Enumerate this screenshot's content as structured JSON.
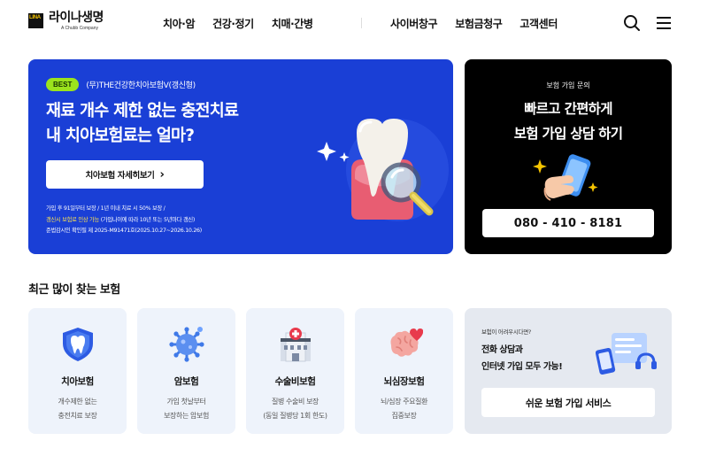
{
  "header": {
    "logo_mark": "LINA",
    "logo_name": "라이나생명",
    "logo_sub": "A Chubb Company",
    "nav_main": [
      "치아·암",
      "건강·정기",
      "치매·간병"
    ],
    "nav_sub": [
      "사이버창구",
      "보험금청구",
      "고객센터"
    ],
    "search_icon": "search-icon",
    "menu_icon": "hamburger-menu-icon"
  },
  "hero": {
    "badge": "BEST",
    "product": "(무)THE건강한치아보험V(갱신형)",
    "title_line1": "재료 개수 제한 없는 충전치료",
    "title_line2": "내 치아보험료는 얼마?",
    "button_label": "치아보험 자세히보기",
    "button_arrow": "›",
    "note1": "가입 후 91일부터 보장 / 1년 이내 치료 시 50% 보장 /",
    "note2_highlight": "갱신시 보험료 인상 가능",
    "note2_rest": " (가입나이에 따라 10년 또는 5년마다 갱신)",
    "note3": "준법감시인 확인필 제 2025-M91471호(2025.10.27~2026.10.26)",
    "bg_color": "#1a3fd6",
    "badge_color": "#9be31d"
  },
  "consult": {
    "label": "보험 가입 문의",
    "title_line1": "빠르고 간편하게",
    "title_line2": "보험 가입 상담 하기",
    "phone": "080 - 410 - 8181"
  },
  "section": {
    "title": "최근 많이 찾는 보험"
  },
  "products": [
    {
      "icon": "tooth-shield-icon",
      "title": "치아보험",
      "desc1": "개수제한 없는",
      "desc2": "충전치료 보장"
    },
    {
      "icon": "virus-cell-icon",
      "title": "암보험",
      "desc1": "가입 첫날부터",
      "desc2": "보장하는 암보험"
    },
    {
      "icon": "hospital-icon",
      "title": "수술비보험",
      "desc1": "질병 수술비 보장",
      "desc2": "(동일 질병당 1회 한도)"
    },
    {
      "icon": "brain-heart-icon",
      "title": "뇌심장보험",
      "desc1": "뇌/심장 주요질환",
      "desc2": "집중보장"
    }
  ],
  "service": {
    "question": "보험이 어려우시다면?",
    "title_line1": "전화 상담과",
    "title_line2": "인터넷 가입 모두 가능!",
    "button_label": "쉬운 보험 가입 서비스"
  }
}
